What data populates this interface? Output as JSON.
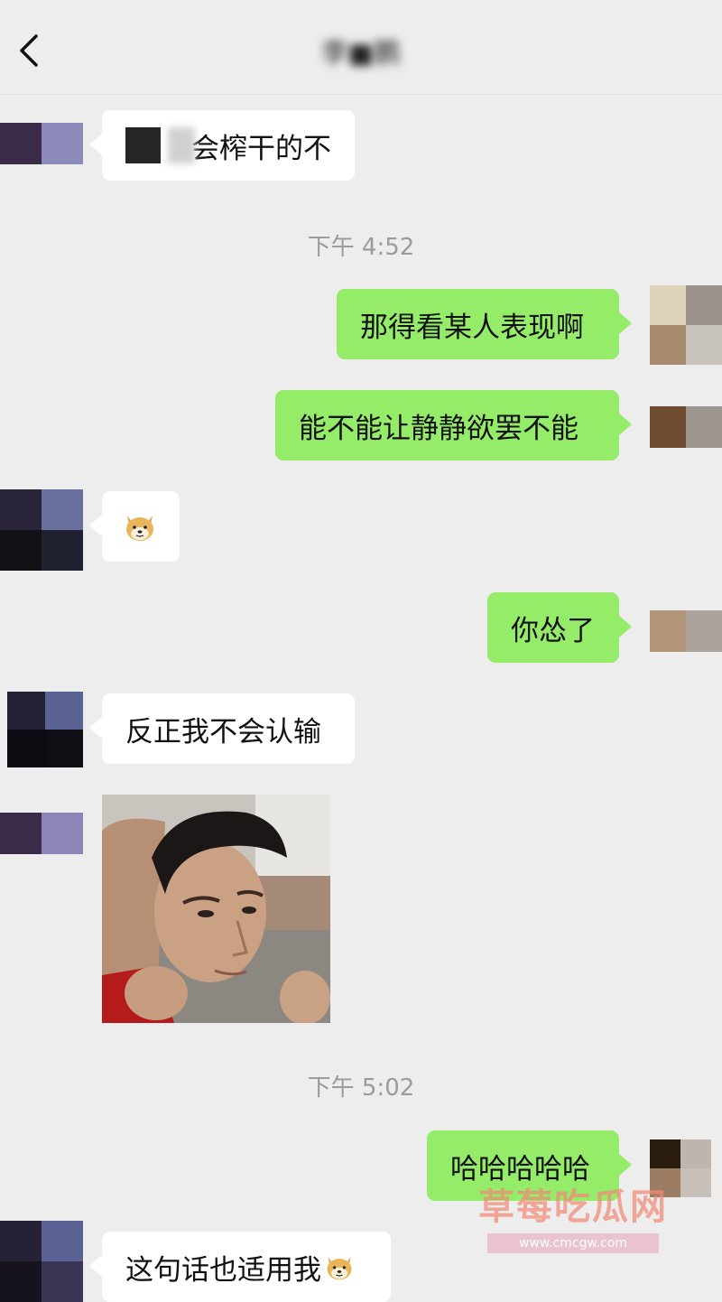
{
  "header": {
    "title": "李■鹏",
    "back_icon": "chevron-left-icon"
  },
  "colors": {
    "background": "#ededed",
    "bubble_out": "#95ec69",
    "bubble_in": "#ffffff",
    "timestamp": "#9b9b9b"
  },
  "messages": [
    {
      "side": "in",
      "text": "会榨干的不"
    },
    {
      "type": "time",
      "text": "下午 4:52"
    },
    {
      "side": "out",
      "text": "那得看某人表现啊"
    },
    {
      "side": "out",
      "text": "能不能让静静欲罢不能"
    },
    {
      "side": "in",
      "icon": "doge-emoji-icon"
    },
    {
      "side": "out",
      "text": "你怂了"
    },
    {
      "side": "in",
      "text": "反正我不会认输"
    },
    {
      "side": "in",
      "type": "image",
      "icon": "photo-sticker"
    },
    {
      "type": "time",
      "text": "下午 5:02"
    },
    {
      "side": "out",
      "text": "哈哈哈哈哈"
    },
    {
      "side": "in",
      "text": "这句话也适用我"
    }
  ],
  "watermark": {
    "text": "草莓吃瓜网",
    "url": "www.cmcgw.com"
  }
}
